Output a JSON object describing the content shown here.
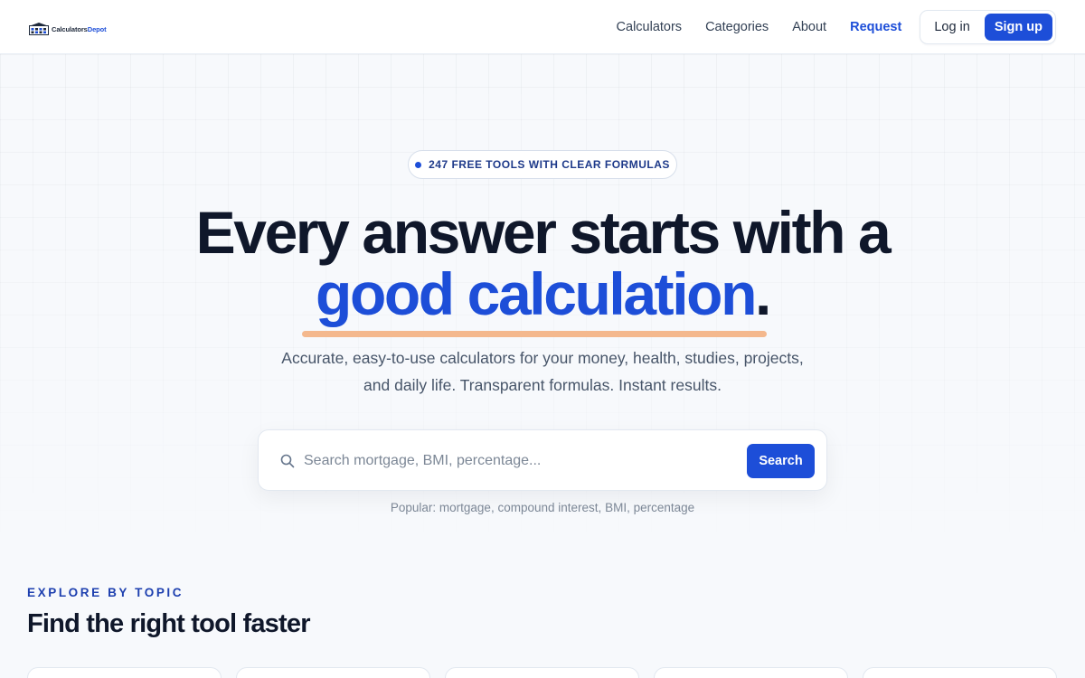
{
  "brand": {
    "name_part1": "Calculators",
    "name_part2": "Depot"
  },
  "nav": {
    "links": [
      "Calculators",
      "Categories",
      "About"
    ],
    "request": "Request",
    "login": "Log in",
    "signup": "Sign up"
  },
  "hero": {
    "badge": "247 FREE TOOLS WITH CLEAR FORMULAS",
    "headline_line1": "Every answer starts with a",
    "headline_accent": "good calculation",
    "headline_period": ".",
    "subtitle_line1": "Accurate, easy-to-use calculators for your money, health, studies, projects,",
    "subtitle_line2": "and daily life. Transparent formulas. Instant results."
  },
  "search": {
    "placeholder": "Search mortgage, BMI, percentage...",
    "value": "",
    "button": "Search",
    "popular_prefix": "Popular:",
    "popular_items": [
      "mortgage",
      "compound interest",
      "BMI",
      "percentage"
    ]
  },
  "explore": {
    "eyebrow": "EXPLORE BY TOPIC",
    "title": "Find the right tool faster"
  },
  "colors": {
    "accent": "#1d4ed8",
    "underline": "#f4b88d",
    "text_dark": "#0f172a",
    "text_muted": "#475569"
  },
  "icons": {
    "logo": "building-icon",
    "search": "search-icon"
  }
}
